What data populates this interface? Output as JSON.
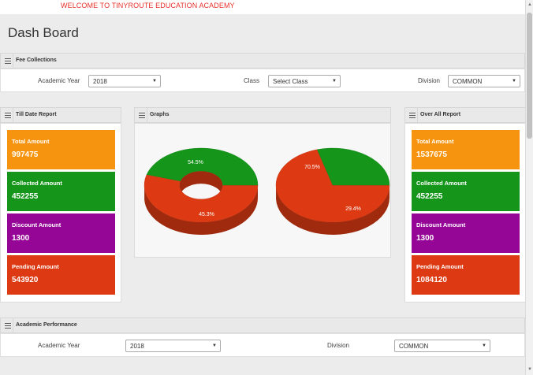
{
  "header": {
    "welcome": "WELCOME TO TINYROUTE EDUCATION ACADEMY"
  },
  "page_title": "Dash Board",
  "fee_collections": {
    "title": "Fee Collections",
    "academic_year_label": "Academic Year",
    "academic_year_value": "2018",
    "class_label": "Class",
    "class_value": "Select Class",
    "division_label": "Division",
    "division_value": "COMMON"
  },
  "till_date_report": {
    "title": "Till Date Report",
    "tiles": [
      {
        "label": "Total Amount",
        "value": "997475",
        "color": "#f7940f"
      },
      {
        "label": "Collected Amount",
        "value": "452255",
        "color": "#15961a"
      },
      {
        "label": "Discount Amount",
        "value": "1300",
        "color": "#950596"
      },
      {
        "label": "Pending Amount",
        "value": "543920",
        "color": "#dd3a13"
      }
    ]
  },
  "graphs": {
    "title": "Graphs"
  },
  "over_all_report": {
    "title": "Over All Report",
    "tiles": [
      {
        "label": "Total Amount",
        "value": "1537675",
        "color": "#f7940f"
      },
      {
        "label": "Collected Amount",
        "value": "452255",
        "color": "#15961a"
      },
      {
        "label": "Discount Amount",
        "value": "1300",
        "color": "#950596"
      },
      {
        "label": "Pending Amount",
        "value": "1084120",
        "color": "#dd3a13"
      }
    ]
  },
  "academic_performance": {
    "title": "Academic Performance",
    "academic_year_label": "Academic Year",
    "academic_year_value": "2018",
    "division_label": "Division",
    "division_value": "COMMON"
  },
  "chart_data": [
    {
      "type": "pie",
      "variant": "donut-3d",
      "slices": [
        {
          "label": "54.5%",
          "value": 54.5,
          "color": "#dd3a13"
        },
        {
          "label": "45.3%",
          "value": 45.3,
          "color": "#15961a"
        }
      ]
    },
    {
      "type": "pie",
      "variant": "pie-3d",
      "slices": [
        {
          "label": "70.5%",
          "value": 70.5,
          "color": "#dd3a13"
        },
        {
          "label": "29.4%",
          "value": 29.4,
          "color": "#15961a"
        }
      ]
    }
  ]
}
